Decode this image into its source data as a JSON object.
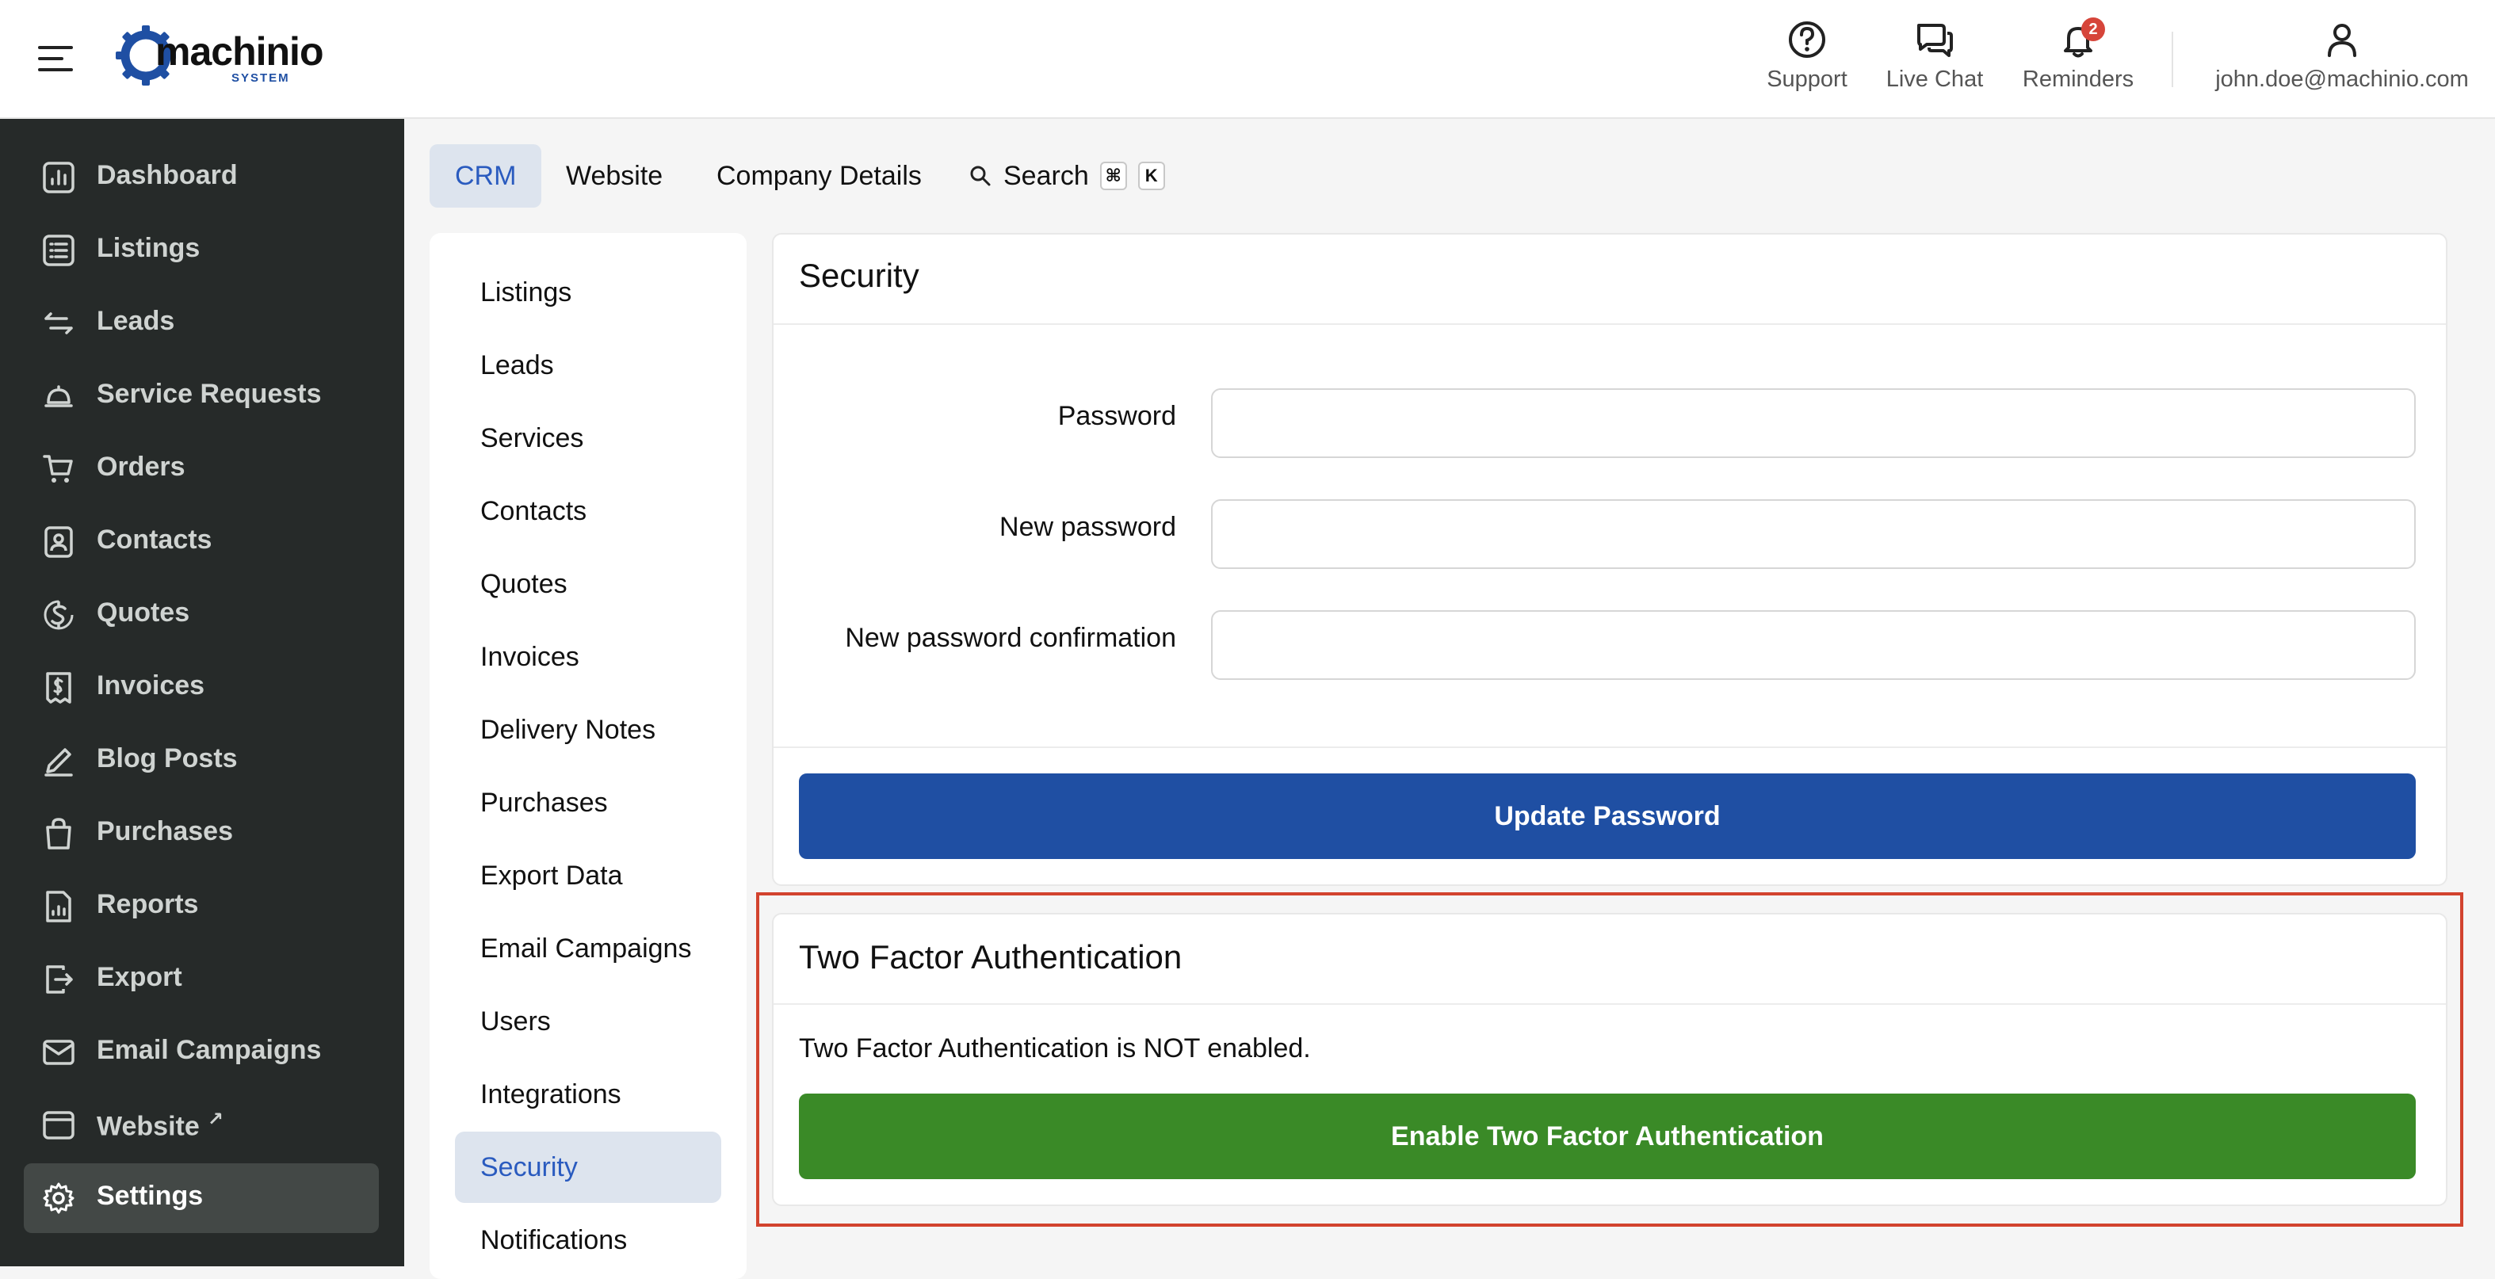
{
  "brand": {
    "name": "machinio",
    "tagline": "SYSTEM"
  },
  "topbar": {
    "actions": [
      {
        "label": "Support",
        "icon": "help-circle-icon"
      },
      {
        "label": "Live Chat",
        "icon": "chat-bubbles-icon"
      },
      {
        "label": "Reminders",
        "icon": "bell-icon",
        "badge": "2"
      }
    ],
    "user": {
      "email": "john.doe@machinio.com",
      "icon": "user-icon"
    }
  },
  "sidebar": {
    "items": [
      {
        "label": "Dashboard",
        "icon": "dashboard-icon"
      },
      {
        "label": "Listings",
        "icon": "list-icon"
      },
      {
        "label": "Leads",
        "icon": "leads-arrows-icon"
      },
      {
        "label": "Service Requests",
        "icon": "service-bell-icon"
      },
      {
        "label": "Orders",
        "icon": "cart-icon"
      },
      {
        "label": "Contacts",
        "icon": "contact-icon"
      },
      {
        "label": "Quotes",
        "icon": "quote-dollar-icon"
      },
      {
        "label": "Invoices",
        "icon": "invoice-icon"
      },
      {
        "label": "Blog Posts",
        "icon": "pen-icon"
      },
      {
        "label": "Purchases",
        "icon": "shopping-bag-icon"
      },
      {
        "label": "Reports",
        "icon": "report-icon"
      },
      {
        "label": "Export",
        "icon": "export-icon"
      },
      {
        "label": "Email Campaigns",
        "icon": "email-campaign-icon"
      },
      {
        "label": "Website",
        "icon": "browser-window-icon",
        "external": "↗"
      },
      {
        "label": "Settings",
        "icon": "gear-icon",
        "active": true
      }
    ]
  },
  "tabs": [
    {
      "label": "CRM",
      "active": true
    },
    {
      "label": "Website"
    },
    {
      "label": "Company Details"
    }
  ],
  "search": {
    "label": "Search",
    "shortcut_mod": "⌘",
    "shortcut_key": "K"
  },
  "settings_menu": [
    "Listings",
    "Leads",
    "Services",
    "Contacts",
    "Quotes",
    "Invoices",
    "Delivery Notes",
    "Purchases",
    "Export Data",
    "Email Campaigns",
    "Users",
    "Integrations",
    "Security",
    "Notifications"
  ],
  "settings_menu_active": "Security",
  "security": {
    "title": "Security",
    "fields": [
      {
        "label": "Password",
        "value": ""
      },
      {
        "label": "New password",
        "value": ""
      },
      {
        "label": "New password confirmation",
        "value": ""
      }
    ],
    "submit_label": "Update Password"
  },
  "two_factor": {
    "title": "Two Factor Authentication",
    "status": "Two Factor Authentication is NOT enabled.",
    "button_label": "Enable Two Factor Authentication"
  },
  "colors": {
    "sidebar_bg": "#262a29",
    "primary_blue": "#1f4fa3",
    "success_green": "#3a8a27",
    "highlight_red": "#d2432e",
    "badge_red": "#d6453a"
  }
}
